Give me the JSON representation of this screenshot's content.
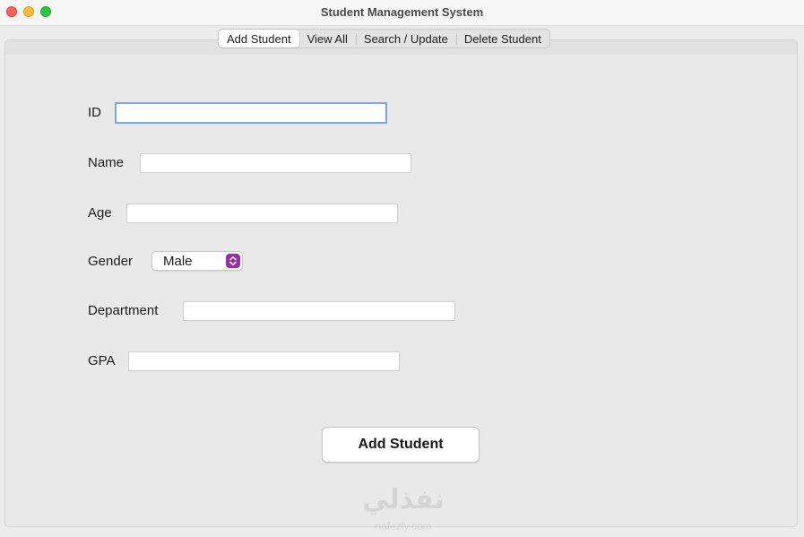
{
  "window": {
    "title": "Student Management System"
  },
  "tabs": [
    {
      "label": "Add Student",
      "active": true
    },
    {
      "label": "View All",
      "active": false
    },
    {
      "label": "Search / Update",
      "active": false
    },
    {
      "label": "Delete Student",
      "active": false
    }
  ],
  "form": {
    "id": {
      "label": "ID",
      "value": ""
    },
    "name": {
      "label": "Name",
      "value": ""
    },
    "age": {
      "label": "Age",
      "value": ""
    },
    "gender": {
      "label": "Gender",
      "selected": "Male"
    },
    "department": {
      "label": "Department",
      "value": ""
    },
    "gpa": {
      "label": "GPA",
      "value": ""
    },
    "submit_label": "Add Student"
  },
  "watermark": {
    "brand": "نفذلي",
    "url": "nafezly.com"
  },
  "colors": {
    "focus_ring": "#7aa7e8",
    "select_arrow": "#9b2ca8",
    "traffic_close": "#fe5f57",
    "traffic_min": "#febc2e",
    "traffic_max": "#28c840"
  }
}
